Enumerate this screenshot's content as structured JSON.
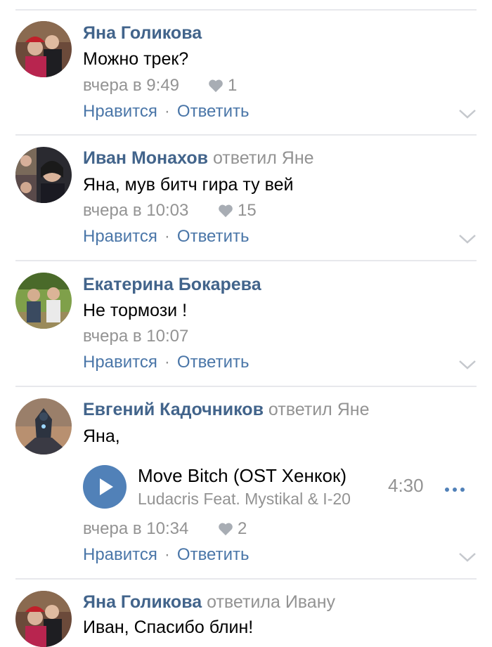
{
  "comments": [
    {
      "author": "Яна Голикова",
      "reply_to": "",
      "text": "Можно трек?",
      "time": "вчера в 9:49",
      "likes": "1",
      "like_label": "Нравится",
      "separator": "·",
      "reply_label": "Ответить",
      "avatar_icon": "user-photo"
    },
    {
      "author": "Иван Монахов",
      "reply_to": "ответил Яне",
      "text": "Яна, мув битч гира ту вей",
      "time": "вчера в 10:03",
      "likes": "15",
      "like_label": "Нравится",
      "separator": "·",
      "reply_label": "Ответить",
      "avatar_icon": "user-photo"
    },
    {
      "author": "Екатерина Бокарева",
      "reply_to": "",
      "text": "Не тормози !",
      "time": "вчера в 10:07",
      "likes": "",
      "like_label": "Нравится",
      "separator": "·",
      "reply_label": "Ответить",
      "avatar_icon": "user-photo"
    },
    {
      "author": "Евгений Кадочников",
      "reply_to": "ответил Яне",
      "text": "Яна,",
      "time": "вчера в 10:34",
      "likes": "2",
      "like_label": "Нравится",
      "separator": "·",
      "reply_label": "Ответить",
      "avatar_icon": "user-photo",
      "attachment": {
        "title": "Move Bitch (OST Хенкок)",
        "artist": "Ludacris Feat. Mystikal & I-20",
        "duration": "4:30"
      }
    },
    {
      "author": "Яна Голикова",
      "reply_to": "ответила Ивану",
      "text": "Иван, Спасибо блин!",
      "avatar_icon": "user-photo"
    }
  ],
  "icons": {
    "like": "heart-icon",
    "expand": "chevron-down-icon",
    "play": "play-icon",
    "more": "more-dots-icon"
  },
  "colors": {
    "author": "#42648b",
    "action": "#4a76a8",
    "muted": "#939393",
    "play_button": "#5181b8",
    "divider": "#e7e8ec"
  }
}
